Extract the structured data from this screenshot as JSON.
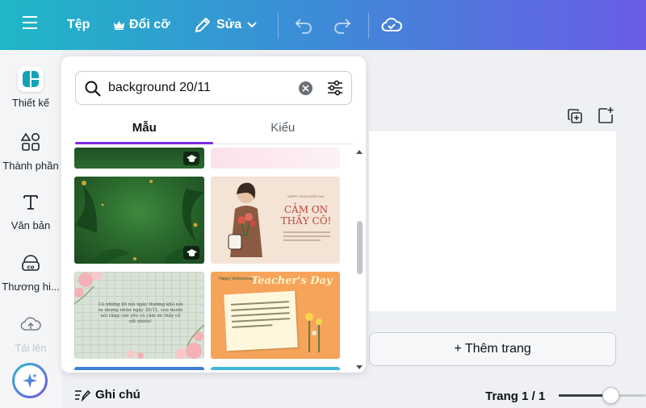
{
  "topbar": {
    "file_label": "Tệp",
    "resize_label": "Đổi cỡ",
    "edit_label": "Sửa"
  },
  "rail": {
    "items": [
      {
        "label": "Thiết kế"
      },
      {
        "label": "Thành phần"
      },
      {
        "label": "Văn bản"
      },
      {
        "label": "Thương hi..."
      },
      {
        "label": "Tải lên"
      }
    ]
  },
  "search": {
    "value": "background 20/11"
  },
  "tabs": [
    {
      "label": "Mẫu",
      "active": true
    },
    {
      "label": "Kiểu",
      "active": false
    }
  ],
  "templates": {
    "thanks_title": "CẢM ƠN\nTHẦY CÔ!",
    "thanks_small": "HAPPY TEACHERS DAY",
    "floral_text": "Có những lời nói ngày thường khó nói ra nhưng nhân ngày 20/11, con muốn nói rằng con yêu và cảm ơn thầy cô rất nhiều!",
    "teachers_day": "Teacher's Day",
    "happy": "Happy Vietnamese"
  },
  "canvas": {
    "add_page_label": "+ Thêm trang",
    "notes_label": "Ghi chú",
    "page_indicator": "Trang 1 / 1"
  },
  "colors": {
    "accent": "#7d2ae8",
    "topbar_start": "#1fb7c7",
    "topbar_end": "#6a5ce6"
  }
}
